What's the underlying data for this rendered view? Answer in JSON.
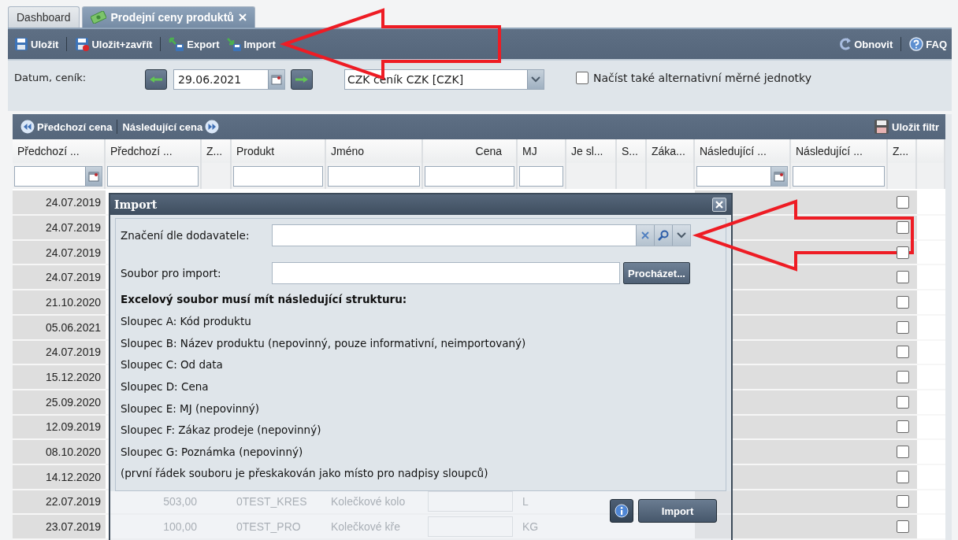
{
  "tabs": [
    {
      "label": "Dashboard",
      "selected": false,
      "closable": false,
      "kind": "plain"
    },
    {
      "label": "Prodejní ceny produktů",
      "selected": true,
      "closable": true,
      "kind": "pricing"
    }
  ],
  "toolbar": {
    "left": [
      {
        "label": "Uložit",
        "kind": "save",
        "separator_before": false,
        "annotated": false
      },
      {
        "label": "Uložit+zavřít",
        "kind": "save-close",
        "separator_before": true,
        "annotated": false
      },
      {
        "label": "Export",
        "kind": "export",
        "separator_before": true,
        "annotated": false
      },
      {
        "label": "Import",
        "kind": "import",
        "separator_before": false,
        "annotated": true
      }
    ],
    "right": [
      {
        "label": "Obnovit",
        "kind": "refresh",
        "separator_before": false
      },
      {
        "label": "FAQ",
        "kind": "help",
        "separator_before": true
      }
    ]
  },
  "filter": {
    "label": "Datum, ceník:",
    "date": "29.06.2021",
    "pricelist": "CZK ceník CZK [CZK]",
    "alt_units": {
      "label": "Načíst také alternativní měrné jednotky",
      "checked": false
    }
  },
  "grid": {
    "toolbar": {
      "prev": "Předchozí cena",
      "next": "Následující cena",
      "save_filter": "Uložit filtr"
    },
    "columns": [
      {
        "label": "Předchozí ...",
        "kind": "date"
      },
      {
        "label": "Předchozí ...",
        "kind": "text"
      },
      {
        "label": "Z...",
        "kind": "plain"
      },
      {
        "label": "Produkt",
        "kind": "text"
      },
      {
        "label": "Jméno",
        "kind": "text"
      },
      {
        "label": "Cena",
        "kind": "number"
      },
      {
        "label": "MJ",
        "kind": "text"
      },
      {
        "label": "Je sl...",
        "kind": "plain"
      },
      {
        "label": "S...",
        "kind": "plain"
      },
      {
        "label": "Záka...",
        "kind": "plain"
      },
      {
        "label": "Následující ...",
        "kind": "date"
      },
      {
        "label": "Následující ...",
        "kind": "text"
      },
      {
        "label": "Z...",
        "kind": "plain"
      }
    ],
    "rows": [
      {
        "date": "24.07.2019",
        "checked": false
      },
      {
        "date": "24.07.2019",
        "checked": false
      },
      {
        "date": "24.07.2019",
        "checked": false
      },
      {
        "date": "24.07.2019",
        "checked": false
      },
      {
        "date": "21.10.2020",
        "checked": false
      },
      {
        "date": "05.06.2021",
        "checked": false
      },
      {
        "date": "24.07.2019",
        "checked": false
      },
      {
        "date": "15.12.2020",
        "checked": false
      },
      {
        "date": "25.09.2020",
        "checked": false
      },
      {
        "date": "12.09.2019",
        "checked": false
      },
      {
        "date": "08.10.2020",
        "checked": false
      },
      {
        "date": "14.12.2020",
        "checked": false
      },
      {
        "date": "22.07.2019",
        "checked": false,
        "prev_price": "503,00",
        "product": "0TEST_KRES",
        "name": "Kolečkové kolo",
        "unit": "L"
      },
      {
        "date": "23.07.2019",
        "checked": false,
        "prev_price": "100,00",
        "product": "0TEST_PRO",
        "name": "Kolečkové kře",
        "unit": "KG"
      }
    ]
  },
  "modal": {
    "title": "Import",
    "fields": [
      {
        "label": "Značení dle dodavatele:",
        "kind": "combo",
        "annotated": true
      },
      {
        "label": "Soubor pro import:",
        "kind": "file",
        "button": "Procházet...",
        "annotated": false
      }
    ],
    "heading": "Excelový soubor musí mít následující strukturu:",
    "lines": [
      "Sloupec A: Kód produktu",
      "Sloupec B: Název produktu (nepovinný, pouze informativní, neimportovaný)",
      "Sloupec C: Od data",
      "Sloupec D: Cena",
      "Sloupec E: MJ (nepovinný)",
      "Sloupec F: Zákaz prodeje (nepovinný)",
      "Sloupec G: Poznámka (nepovinný)",
      "(první řádek souboru je přeskakován jako místo pro nadpisy sloupců)"
    ],
    "buttons": [
      {
        "kind": "info"
      },
      {
        "kind": "primary",
        "label": "Import"
      }
    ]
  }
}
